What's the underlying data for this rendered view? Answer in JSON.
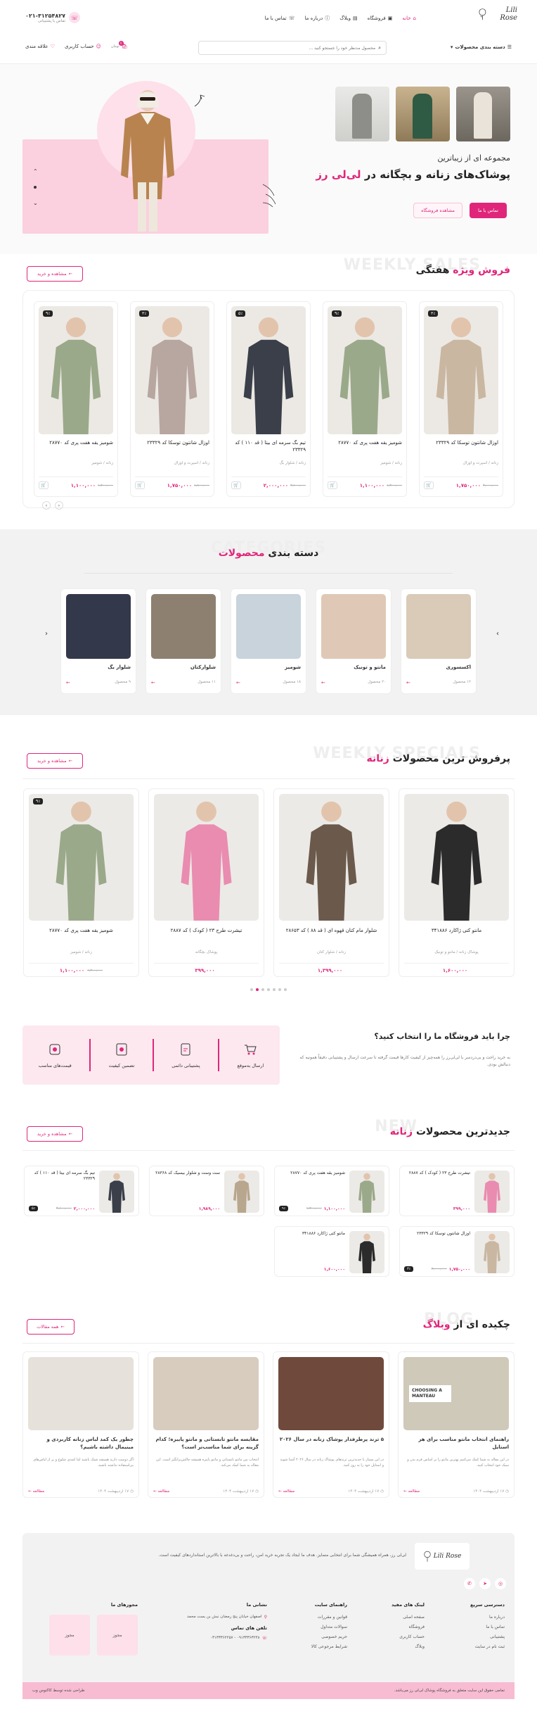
{
  "header": {
    "logo": "Lili Rose",
    "nav": [
      "خانه",
      "فروشگاه",
      "وبلاگ",
      "درباره ما",
      "تماس با ما"
    ],
    "phone": "۰۲۱-۳۱۲۵۴۸۲۷",
    "phone_caption": "تماس با پشتیبانی",
    "categories_label": "دسته بندی محصولات",
    "search_placeholder": "محصول مدنظر خود را جستجو کنید ...",
    "account": "حساب کاربری",
    "wishlist": "علاقه مندی",
    "cart_label": "تومان",
    "cart_count": "0",
    "accent": "#e0267a"
  },
  "hero": {
    "line1": "مجموعه ای از زیباترین",
    "line2a": "پوشاک‌های زنانه و بچگانه در ",
    "line2b": "لی‌لی رز",
    "btn_contact": "تماس با ما",
    "btn_shop": "مشاهده فروشگاه"
  },
  "weekly": {
    "title_a": "فروش ",
    "title_b": "ویژه",
    "title_c": " هفتگی",
    "ghost": "WEEKLY SALES",
    "view": "مشاهده و خرید",
    "products": [
      {
        "name": "اوزال شانتون توسکا کد ۲۳۳۲۹",
        "cat": "زنانه / اسپرت و اوزال",
        "price": "۱,۷۵۰,۰۰۰",
        "old": "۲,۰۰۰,۰۰۰",
        "badge": "۳٪",
        "tone": "#c9b7a2"
      },
      {
        "name": "شومیز یقه هفت پری کد ۲۸۷۷۰",
        "cat": "زنانه / شومیز",
        "price": "۱,۱۰۰,۰۰۰",
        "old": "۱,۲۰۰,۰۰۰",
        "badge": "۹٪",
        "tone": "#9aa98a"
      },
      {
        "name": "تیم بگ سرمه ای بیتا ( قد ۱۱۰ ) کد ۲۳۳۲۹",
        "cat": "زنانه / شلوار بگ",
        "price": "۲,۰۰۰,۰۰۰",
        "old": "۲,۱۰۰,۰۰۰",
        "badge": "۵٪",
        "tone": "#3a3f4a"
      },
      {
        "name": "اوزال شانتون توسکا کد ۲۳۳۲۹",
        "cat": "زنانه / اسپرت و اوزال",
        "price": "۱,۷۵۰,۰۰۰",
        "old": "۱,۸۰۰,۰۰۰",
        "badge": "۳٪",
        "tone": "#b8a6a0"
      },
      {
        "name": "شومیز یقه هفت پری کد ۲۸۷۷۰",
        "cat": "زنانه / شومیز",
        "price": "۱,۱۰۰,۰۰۰",
        "old": "۱,۲۰۰,۰۰۰",
        "badge": "۹٪",
        "tone": "#9aa98a"
      }
    ]
  },
  "categories": {
    "ghost": "CATEGORIES",
    "title_a": "دسته بندی ",
    "title_b": "محصولات",
    "items": [
      {
        "name": "اکسسوری",
        "count": "۱۲ محصول",
        "tone": "#d9cbb8"
      },
      {
        "name": "مانتو و تونیک",
        "count": "۲۰ محصول",
        "tone": "#dfc9b6"
      },
      {
        "name": "شومیز",
        "count": "۱۸ محصول",
        "tone": "#c9d3dc"
      },
      {
        "name": "شلوارکتان",
        "count": "۱۱ محصول",
        "tone": "#8e8070"
      },
      {
        "name": "شلوار بگ",
        "count": "۹ محصول",
        "tone": "#33384a"
      }
    ]
  },
  "bestsellers": {
    "ghost": "WEEKLY SPECIALS",
    "title_a": "پرفروش ترین محصولات ",
    "title_b": "زنانه",
    "view": "مشاهده و خرید",
    "products": [
      {
        "name": "مانتو کتی ژاکارد ۳۴۱۸۸۶",
        "cat": "پوشاک زنانه / مانتو و تونیک",
        "price": "۱,۶۰۰,۰۰۰",
        "old": "",
        "tone": "#2b2b2b"
      },
      {
        "name": "شلوار مام کتان قهوه ای ( قد ۸۸ ) کد ۲۸۶۵۳",
        "cat": "زنانه / شلوار کتان",
        "price": "۱,۳۹۹,۰۰۰",
        "old": "",
        "tone": "#6b5a4c"
      },
      {
        "name": "تیشرت طرح ۲۳ ( کودک ) کد ۲۸۸۷",
        "cat": "پوشاک بچگانه",
        "price": "۳۹۹,۰۰۰",
        "old": "",
        "tone": "#e98cb0"
      },
      {
        "name": "شومیز یقه هفت پری کد ۲۸۷۷۰",
        "cat": "زنانه / شومیز",
        "price": "۱,۱۰۰,۰۰۰",
        "old": "۱,۲۰۰,۰۰۰",
        "badge": "۹٪",
        "tone": "#9aa98a"
      }
    ]
  },
  "why": {
    "title": "چرا باید فروشگاه ما را انتخاب کنید؟",
    "text": "به خرید راحت و بی‌دردسر با لی‌لی‌رز را همه‌چیز از کیفیت کارها قیمت گرفته تا سرعت ارسال و پشتیبانی دقیقاً همونیه که دنبالش بودی.",
    "features": [
      "قیمت‌های مناسب",
      "تضمین کیفیت",
      "پشتیبانی دائمی",
      "ارسال به‌موقع"
    ]
  },
  "newest": {
    "ghost": "NEW",
    "title_a": "جدیدترین محصولات ",
    "title_b": "زنانه",
    "view": "مشاهده و خرید",
    "items": [
      {
        "name": "تیشرت طرح ۲۳ ( کودک ) کد ۲۸۸۷",
        "price": "۳۹۹,۰۰۰",
        "old": "",
        "badge": "",
        "tone": "#e98cb0"
      },
      {
        "name": "شومیز یقه هفت پری کد ۲۸۷۷۰",
        "price": "۱,۱۰۰,۰۰۰",
        "old": "۱,۲۰۰,۰۰۰",
        "badge": "۹٪",
        "tone": "#9aa98a"
      },
      {
        "name": "ست وست و شلوار بیسیک کد ۲۸۳۶۸",
        "price": "۱,۹۸۹,۰۰۰",
        "old": "",
        "badge": "",
        "tone": "#b9a68e"
      },
      {
        "name": "تیم بگ سرمه ای بیتا ( قد ۱۱۰ ) کد ۲۳۳۲۹",
        "price": "۲,۰۰۰,۰۰۰",
        "old": "۲,۱۰۰,۰۰۰",
        "badge": "۵٪",
        "tone": "#3a3f4a"
      },
      {
        "name": "اوزال شانتون توسکا کد ۲۳۳۲۹",
        "price": "۱,۷۵۰,۰۰۰",
        "old": "۲,۰۰۰,۰۰۰",
        "badge": "۳٪",
        "tone": "#c9b7a2"
      },
      {
        "name": "مانتو کتی ژاکارد ۳۴۱۸۸۶",
        "price": "۱,۶۰۰,۰۰۰",
        "old": "",
        "badge": "",
        "tone": "#2b2b2b"
      }
    ]
  },
  "blog": {
    "ghost": "BLOG",
    "title_a": "چکیده ای از ",
    "title_b": "وبلاگ",
    "view": "همه مقالات",
    "read": "مطالعه",
    "posts": [
      {
        "title": "راهنمای انتخاب مانتو مناسب برای هر استایل",
        "text": "در این مقاله به شما کمک می‌کنیم بهترین مانتو را بر اساس فرم بدن و سبک خود انتخاب کنید.",
        "date": "۱۷ اردیبهشت ۱۴۰۴",
        "tone": "#cfc9b9",
        "overlay": "CHOOSING A MANTEAU"
      },
      {
        "title": "۵ ترند پرطرفدار پوشاک زنانه در سال ۲۰۲۶",
        "text": "در این بسیار با جدیدترین ترندهای پوشاک زنانه در سال ۲۰۲۶ آشنا شوید و استایل خود را به روز کنید.",
        "date": "۱۷ اردیبهشت ۱۴۰۴",
        "tone": "#6f4a3c",
        "overlay": ""
      },
      {
        "title": "مقایسه مانتو تابستانی و مانتو پاییزه؛ کدام گزینه برای شما مناسب‌تر است؟",
        "text": "انتخاب بین مانتو تابستانی و مانتو پاییزه همیشه چالش‌برانگیز است. این مقاله به شما کمک می‌کند.",
        "date": "۱۷ اردیبهشت ۱۴۰۴",
        "tone": "#d8ccbf",
        "overlay": ""
      },
      {
        "title": "چطور یک کمد لباس زنانه کاربردی و مینیمال داشته باشیم؟",
        "text": "اگر دوست دارید همیشه شیک باشید اما کمدی شلوغ و پر از لباس‌های بی‌استفاده نداشته باشید.",
        "date": "۱۷ اردیبهشت ۱۴۰۴",
        "tone": "#e6e1da",
        "overlay": ""
      }
    ]
  },
  "footer": {
    "logo": "Lili Rose",
    "about": "لی‌لی رز، همراه همیشگی شما برای انتخابی متمایز. هدف ما ایجاد یک تجربه خرید امن، راحت و بی‌دغدغه با بالاترین استانداردهای کیفیت است.",
    "col1_title": "دسترسی سریع",
    "col1": [
      "درباره ما",
      "تماس با ما",
      "پشتیبانی",
      "ثبت نام در سایت"
    ],
    "col2_title": "لینک های مفید",
    "col2": [
      "صفحه اصلی",
      "فروشگاه",
      "حساب کاربری",
      "وبلاگ"
    ],
    "col3_title": "راهنمای سایت",
    "col3": [
      "قوانین و مقررات",
      "سوالات متداول",
      "حریم خصوصی",
      "شرایط مرجوعی کالا"
    ],
    "col4_title": "نشانی ما",
    "address": "اصفهان خیابان پنج رمضان نبش بن بست محمد",
    "phones_title": "تلفن های تماس",
    "phones": "۰۹۱۳۳۳۶۳۲۴۸ - ۰۳۱۳۳۳۶۲۲۵۷",
    "col5_title": "مجوزهای ما",
    "license": "مجوز",
    "copyright": "تمامی حقوق این سایت متعلق به فروشگاه پوشاک لی‌لی رز می‌باشد.",
    "designer": "طراحی شده توسط کاکتوس وب"
  }
}
